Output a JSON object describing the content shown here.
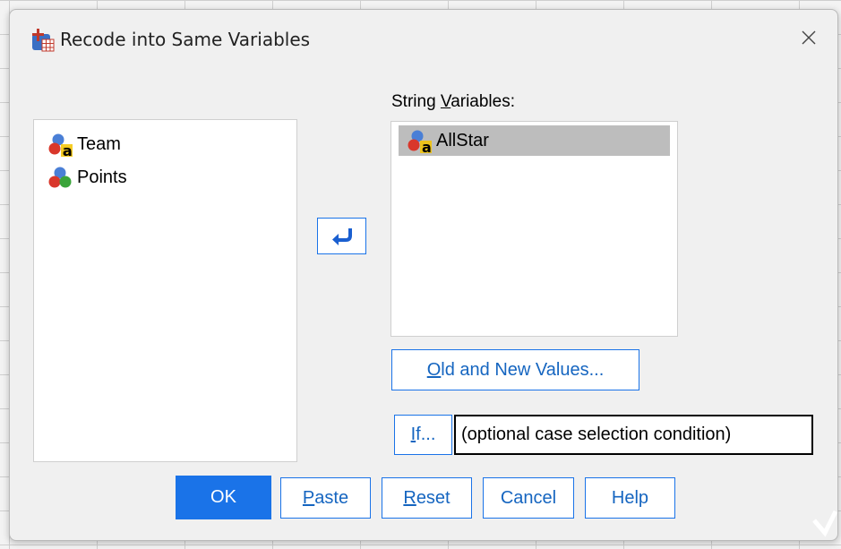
{
  "window": {
    "title": "Recode into Same Variables",
    "close_glyph": "✕",
    "app_icon": "spss-recode-icon"
  },
  "source_list": {
    "items": [
      {
        "label": "Team",
        "icon": "string-variable-icon"
      },
      {
        "label": "Points",
        "icon": "scale-variable-icon"
      }
    ]
  },
  "target_list": {
    "label_prefix": "String ",
    "label_mnemonic": "V",
    "label_suffix": "ariables:",
    "items": [
      {
        "label": "AllStar",
        "icon": "string-variable-icon",
        "selected": true
      }
    ]
  },
  "move_button": {
    "icon": "arrow-left-icon"
  },
  "old_new_button": {
    "mnemonic": "O",
    "rest": "ld and New Values..."
  },
  "if_button": {
    "mnemonic": "I",
    "rest": "f..."
  },
  "condition_text": "(optional case selection condition)",
  "buttons": {
    "ok": "OK",
    "paste": {
      "mnemonic": "P",
      "rest": "aste"
    },
    "reset": {
      "mnemonic": "R",
      "rest": "eset"
    },
    "cancel": "Cancel",
    "help": "Help"
  },
  "colors": {
    "accent": "#1a73e8",
    "selected_row": "#bdbdbd",
    "button_text": "#1565c0"
  }
}
